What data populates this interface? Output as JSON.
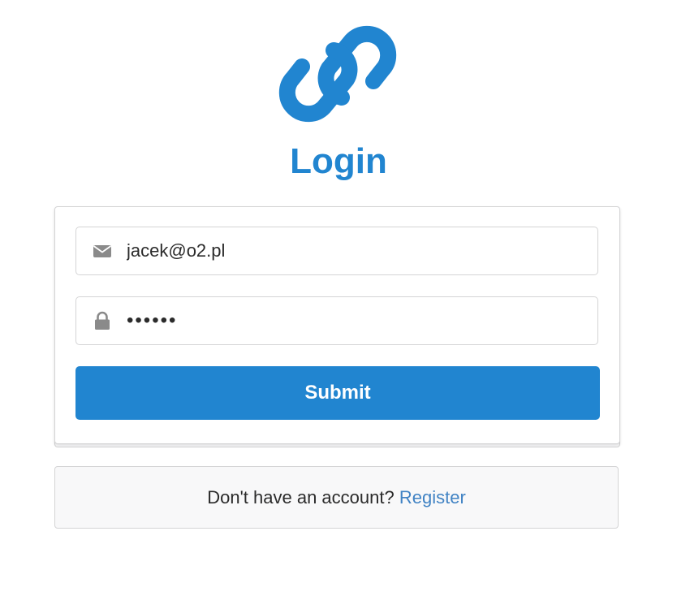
{
  "page": {
    "title": "Login",
    "logo_icon": "chain-link-icon",
    "accent_color": "#2185d0"
  },
  "form": {
    "email": {
      "icon": "envelope-icon",
      "value": "jacek@o2.pl"
    },
    "password": {
      "icon": "lock-icon",
      "value": "••••••"
    },
    "submit_label": "Submit"
  },
  "footer": {
    "text": "Don't have an account?",
    "link_label": "Register"
  }
}
